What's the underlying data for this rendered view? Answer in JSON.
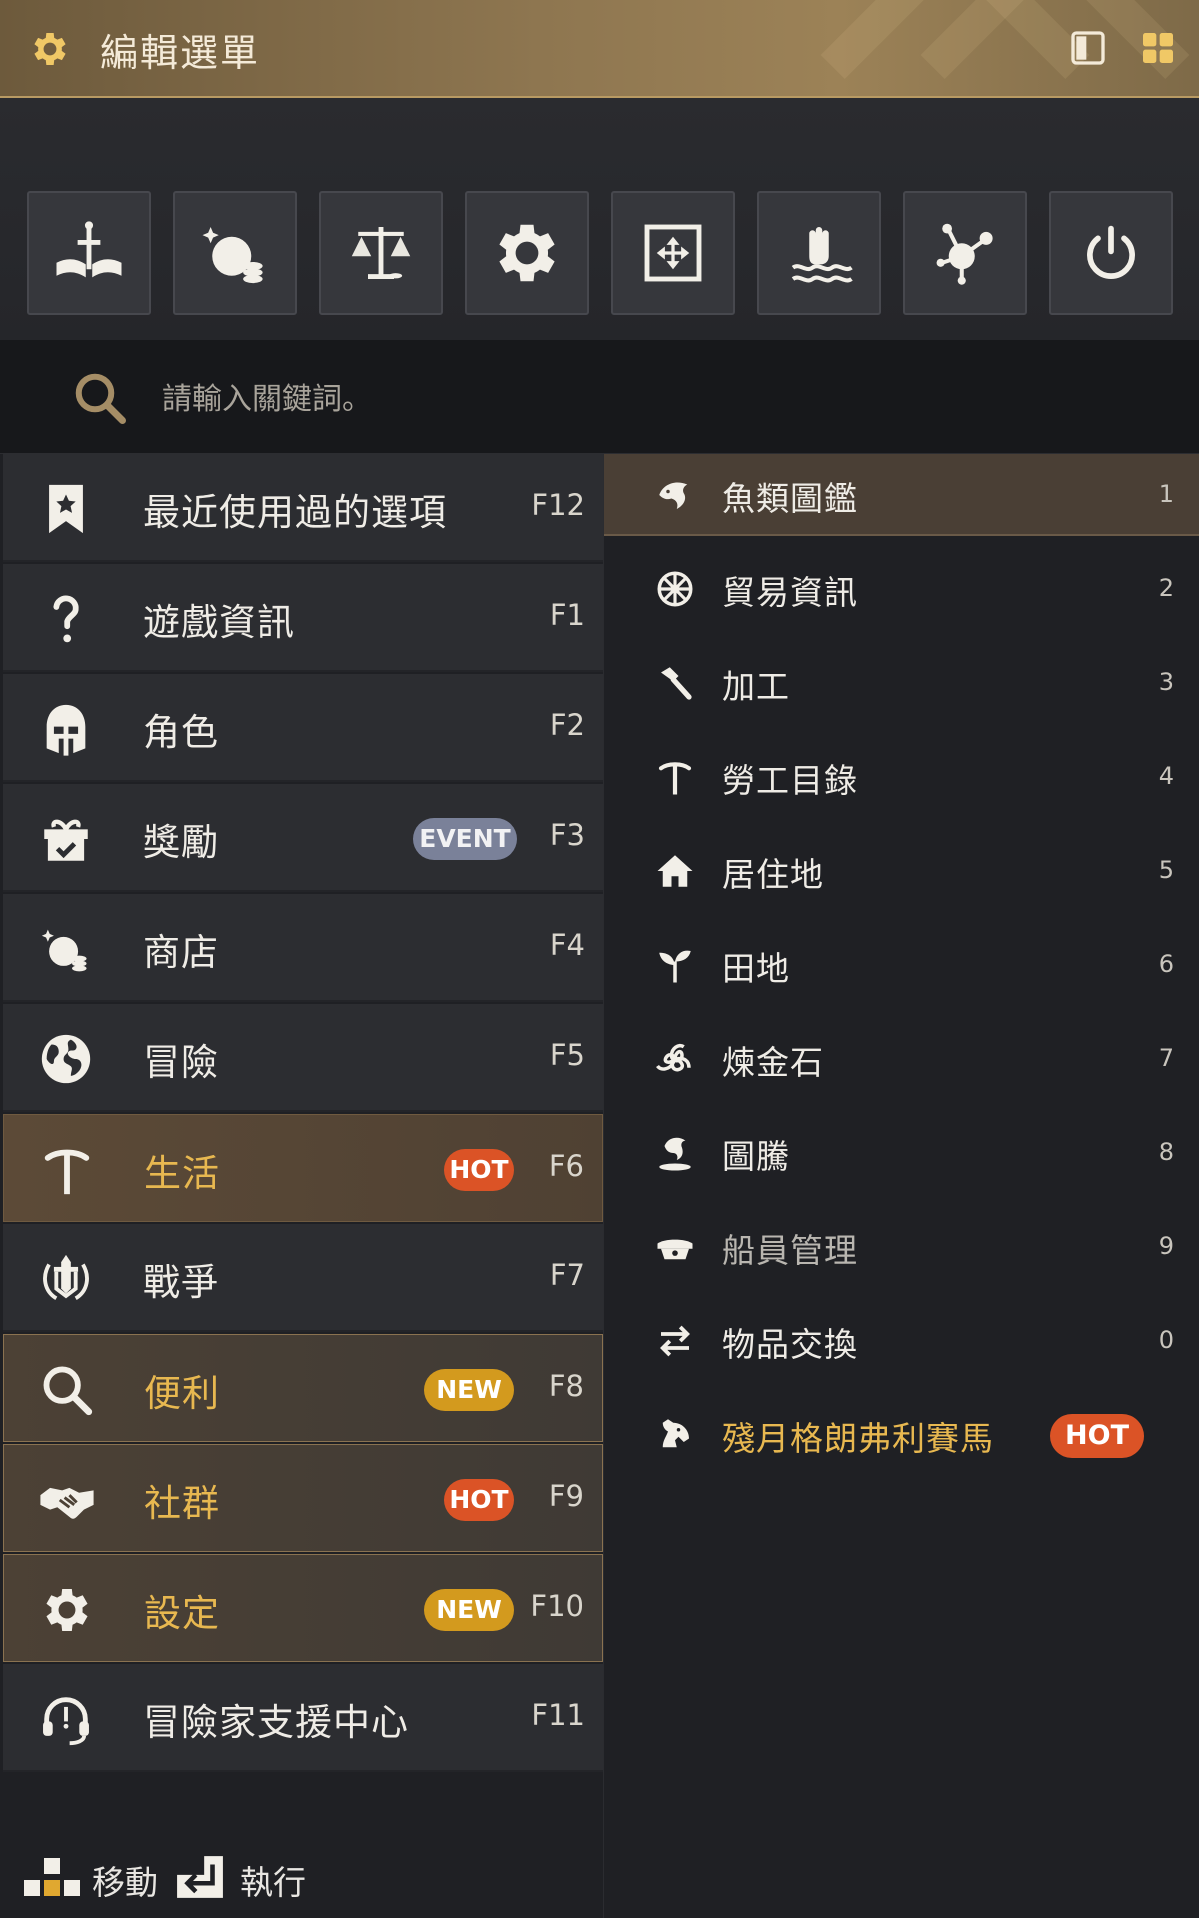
{
  "header": {
    "title": "編輯選單",
    "icons": [
      "gear-icon",
      "layout-toggle-icon",
      "grid-icon"
    ]
  },
  "quickbar": {
    "buttons": [
      {
        "icon": "sword-book-icon"
      },
      {
        "icon": "pearl-shop-icon"
      },
      {
        "icon": "scales-icon"
      },
      {
        "icon": "gear-icon"
      },
      {
        "icon": "move-frame-icon"
      },
      {
        "icon": "hand-water-icon"
      },
      {
        "icon": "network-node-icon"
      },
      {
        "icon": "power-icon"
      }
    ]
  },
  "search": {
    "placeholder": "請輸入關鍵詞。"
  },
  "menu": {
    "items": [
      {
        "label": "最近使用過的選項",
        "key": "F12",
        "icon": "bookmark-star-icon",
        "badge": ""
      },
      {
        "label": "遊戲資訊",
        "key": "F1",
        "icon": "question-icon",
        "badge": ""
      },
      {
        "label": "角色",
        "key": "F2",
        "icon": "helmet-icon",
        "badge": ""
      },
      {
        "label": "獎勵",
        "key": "F3",
        "icon": "gift-check-icon",
        "badge": "EVENT"
      },
      {
        "label": "商店",
        "key": "F4",
        "icon": "pearl-shop-icon",
        "badge": ""
      },
      {
        "label": "冒險",
        "key": "F5",
        "icon": "globe-icon",
        "badge": ""
      },
      {
        "label": "生活",
        "key": "F6",
        "icon": "pickaxe-icon",
        "badge": "HOT"
      },
      {
        "label": "戰爭",
        "key": "F7",
        "icon": "war-emblem-icon",
        "badge": ""
      },
      {
        "label": "便利",
        "key": "F8",
        "icon": "search-icon",
        "badge": "NEW"
      },
      {
        "label": "社群",
        "key": "F9",
        "icon": "handshake-icon",
        "badge": "HOT"
      },
      {
        "label": "設定",
        "key": "F10",
        "icon": "gear-icon",
        "badge": "NEW"
      },
      {
        "label": "冒險家支援中心",
        "key": "F11",
        "icon": "headset-icon",
        "badge": ""
      }
    ]
  },
  "submenu": {
    "items": [
      {
        "label": "魚類圖鑑",
        "key": "1",
        "icon": "fish-icon",
        "badge": ""
      },
      {
        "label": "貿易資訊",
        "key": "2",
        "icon": "wheel-icon",
        "badge": ""
      },
      {
        "label": "加工",
        "key": "3",
        "icon": "hammer-icon",
        "badge": ""
      },
      {
        "label": "勞工目錄",
        "key": "4",
        "icon": "pickaxe-icon",
        "badge": ""
      },
      {
        "label": "居住地",
        "key": "5",
        "icon": "house-icon",
        "badge": ""
      },
      {
        "label": "田地",
        "key": "6",
        "icon": "sprout-icon",
        "badge": ""
      },
      {
        "label": "煉金石",
        "key": "7",
        "icon": "triskelion-icon",
        "badge": ""
      },
      {
        "label": "圖騰",
        "key": "8",
        "icon": "totem-icon",
        "badge": ""
      },
      {
        "label": "船員管理",
        "key": "9",
        "icon": "sailor-hat-icon",
        "badge": ""
      },
      {
        "label": "物品交換",
        "key": "0",
        "icon": "swap-arrows-icon",
        "badge": ""
      },
      {
        "label": "殘月格朗弗利賽馬",
        "key": "",
        "icon": "horse-head-icon",
        "badge": "HOT"
      }
    ]
  },
  "footer": {
    "move_label": "移動",
    "execute_label": "執行"
  }
}
